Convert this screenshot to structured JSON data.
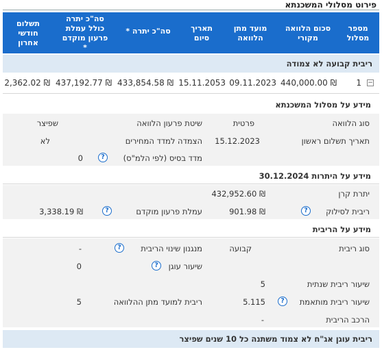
{
  "page_title": "פירוט מסלולי המשכנתא",
  "table_header": {
    "track_number": [
      "מספר",
      "מסלול"
    ],
    "original_amount": [
      "סכום הלוואה",
      "מקורי"
    ],
    "loan_date": [
      "מועד מתן",
      "הלוואה"
    ],
    "end_date": [
      "תאריך",
      "סיום"
    ],
    "total_balance": "סה\"כ יתרה *",
    "total_balance_with_fee": [
      "סה\"כ יתרה",
      "כולל עמלת",
      "פרעון מוקדם",
      "*"
    ],
    "last_payment": [
      "תשלום",
      "חודשי",
      "אחרון"
    ]
  },
  "track_band_title": "ריבית קבועה לא צמודה",
  "track_row": {
    "number": "1",
    "expand_symbol": "−",
    "original_amount": "₪ 440,000.00",
    "loan_date": "09.11.2023",
    "end_date": "15.11.2053",
    "total_balance": "₪ 433,854.58",
    "total_with_fee": "₪ 437,192.77",
    "last_payment": "₪ 2,362.02"
  },
  "track_info": {
    "heading": "מידע על מסלול המשכנתא",
    "loan_type_label": "סוג הלוואה",
    "loan_type_value": "פרטית",
    "repayment_method_label": "שיטת פרעון הלוואה",
    "repayment_method_value": "שפיצר",
    "first_payment_label": "תאריך תשלום ראשון",
    "first_payment_value": "15.12.2023",
    "index_link_label": "הצמדה למדד המחירים",
    "index_link_value": "לא",
    "base_index_label": "מדד בסיס (לפי הלמ\"ס)",
    "base_index_value": "0"
  },
  "balances": {
    "heading": "מידע על היתרות 30.12.2024",
    "principal_label": "יתרת קרן",
    "principal_value": "₪ 432,952.60",
    "payoff_interest_label": "ריבית לסילוק",
    "payoff_interest_value": "₪ 901.98",
    "early_fee_label": "עמלת פרעון מוקדם",
    "early_fee_value": "₪ 3,338.19"
  },
  "interest": {
    "heading": "מידע על הריבית",
    "type_label": "סוג ריבית",
    "type_value": "קבועה",
    "change_mechanism_label": "מנגנון שינוי הריבית",
    "change_mechanism_value": "-",
    "anchor_rate_label": "שיעור עוגן",
    "anchor_rate_value": "0",
    "annual_rate_label": "שיעור ריבית שנתית",
    "annual_rate_value": "5",
    "adjusted_rate_label": "שיעור ריבית מותאמת",
    "adjusted_rate_value": "5.115",
    "rate_at_loan_label": "ריבית למועד מתן ההלוואה",
    "rate_at_loan_value": "5",
    "composition_label": "הרכב הריבית",
    "composition_value": "-"
  },
  "bottom_band_title": "ריבית עוגן אג\"ח לא צמוד משתנה כל 10 שנים שפיצר",
  "help_symbol": "?",
  "colors": {
    "header_blue": "#1a6dcc",
    "band_blue": "#dde9f4",
    "section_gray": "#f2f2f2"
  }
}
